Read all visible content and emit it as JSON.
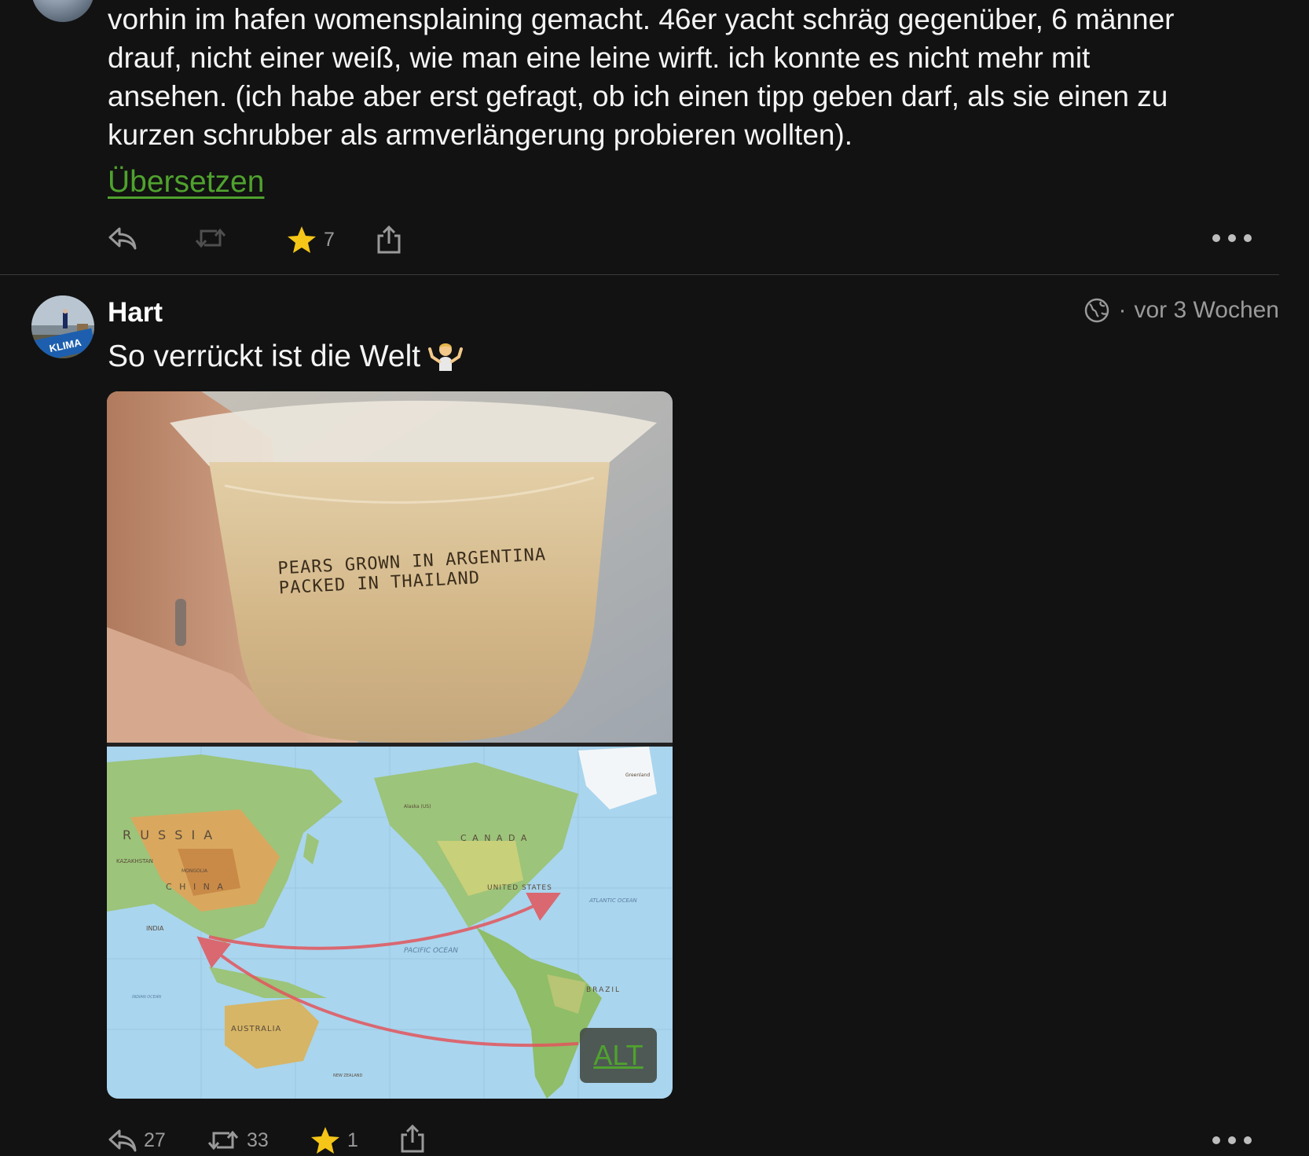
{
  "post1": {
    "text": "vorhin im hafen womensplaining gemacht. 46er yacht schräg gegenüber, 6 männer\ndrauf, nicht einer weiß, wie man eine leine wirft. ich konnte es nicht mehr mit\nansehen. (ich habe aber erst gefragt, ob ich einen tipp geben darf, als sie einen zu\nkurzen schrubber als armverlängerung probieren wollten).",
    "translate_label": "Übersetzen",
    "actions": {
      "favourites_count": "7"
    }
  },
  "post2": {
    "author": "Hart",
    "visibility_icon": "globe-icon",
    "time": "vor 3 Wochen",
    "separator": "·",
    "text": "So verrückt ist die Welt",
    "emoji": "🤷",
    "avatar_badge": "KLIMA",
    "image_texts": {
      "line1": "PEARS GROWN IN ARGENTINA",
      "line2": "PACKED IN THAILAND",
      "map_labels": [
        "R U S S I A",
        "C A N A D A",
        "UNITED STATES",
        "C H I N A",
        "INDIA",
        "AUSTRALIA",
        "BRAZIL",
        "PACIFIC OCEAN",
        "ATLANTIC OCEAN",
        "KAZAKHSTAN",
        "MONGOLIA",
        "Greenland",
        "Alaska (US)",
        "NEW ZEALAND",
        "INDIAN OCEAN"
      ]
    },
    "alt_label": "ALT",
    "actions": {
      "replies_count": "27",
      "boosts_count": "33",
      "favourites_count": "1"
    }
  },
  "colors": {
    "background": "#121212",
    "accent_green": "#4fa22e",
    "star": "#f5c518",
    "muted": "#9a9a9a"
  }
}
